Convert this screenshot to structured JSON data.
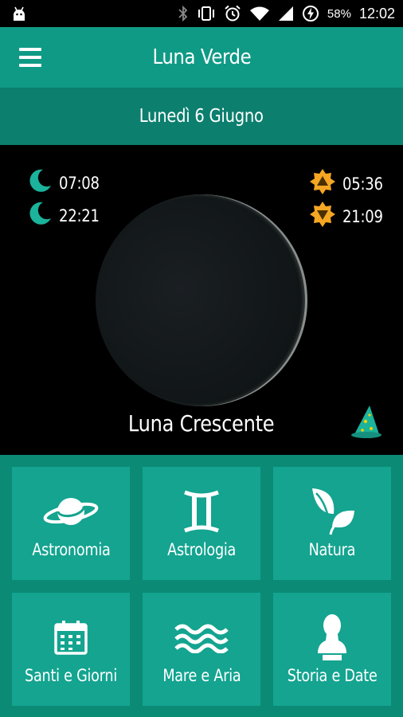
{
  "status_bar": {
    "battery_percent": "58%",
    "time": "12:02",
    "icons": [
      "android-icon",
      "bluetooth-icon",
      "vibrate-icon",
      "alarm-icon",
      "wifi-icon",
      "signal-icon",
      "battery-charging-icon"
    ]
  },
  "app_bar": {
    "title": "Luna Verde",
    "menu_icon": "hamburger-menu-icon"
  },
  "date_bar": {
    "date": "Lunedì 6 Giugno"
  },
  "moon_panel": {
    "moonrise": "07:08",
    "moonset": "22:21",
    "sunrise": "05:36",
    "sunset": "21:09",
    "phase": "Luna Crescente",
    "wizard_icon": "wizard-hat-icon"
  },
  "tiles": [
    {
      "label": "Astronomia",
      "icon": "planet-icon"
    },
    {
      "label": "Astrologia",
      "icon": "gemini-icon"
    },
    {
      "label": "Natura",
      "icon": "leaves-icon"
    },
    {
      "label": "Santi e Giorni",
      "icon": "calendar-icon"
    },
    {
      "label": "Mare e Aria",
      "icon": "waves-icon"
    },
    {
      "label": "Storia e Date",
      "icon": "bust-icon"
    }
  ],
  "colors": {
    "primary": "#0f9a86",
    "primary_dark": "#0c7f6e",
    "tile": "#14a490",
    "background": "#0b8a76",
    "sun_orange": "#f5a623",
    "moon_icon_teal": "#1bb39c"
  }
}
